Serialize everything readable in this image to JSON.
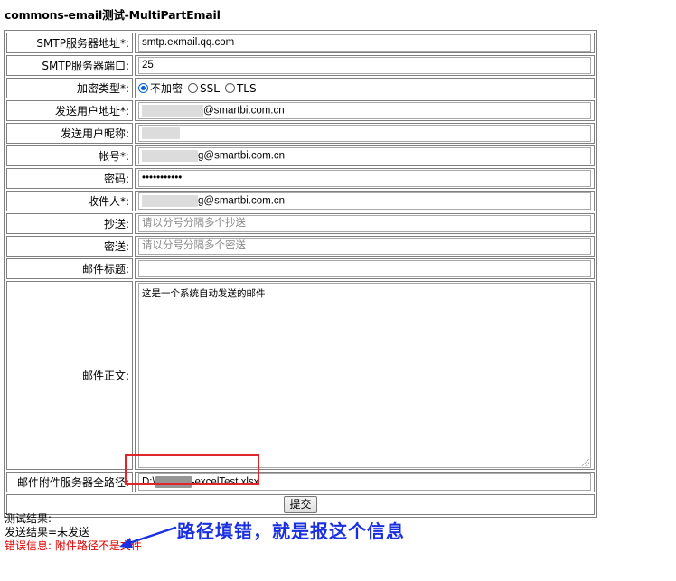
{
  "page": {
    "title": "commons-email测试-MultiPartEmail"
  },
  "form": {
    "smtp_host": {
      "label": "SMTP服务器地址*:",
      "value": "smtp.exmail.qq.com"
    },
    "smtp_port": {
      "label": "SMTP服务器端口:",
      "value": "25"
    },
    "encryption": {
      "label": "加密类型*:",
      "options": [
        "不加密",
        "SSL",
        "TLS"
      ],
      "selected": "不加密"
    },
    "sender_address": {
      "label": "发送用户地址*:",
      "value_suffix": "@smartbi.com.cn"
    },
    "sender_nickname": {
      "label": "发送用户昵称:"
    },
    "account": {
      "label": "帐号*:",
      "value_suffix": "g@smartbi.com.cn"
    },
    "password": {
      "label": "密码:",
      "value": "•••••••••••"
    },
    "recipient": {
      "label": "收件人*:",
      "value_suffix": "g@smartbi.com.cn"
    },
    "cc": {
      "label": "抄送:",
      "placeholder": "请以分号分隔多个抄送"
    },
    "bcc": {
      "label": "密送:",
      "placeholder": "请以分号分隔多个密送"
    },
    "subject": {
      "label": "邮件标题:",
      "value": ""
    },
    "body": {
      "label": "邮件正文:",
      "value": "这是一个系统自动发送的邮件"
    },
    "attachment_path": {
      "label": "邮件附件服务器全路径:",
      "value_prefix": "D:\\",
      "value_suffix": "-excelTest.xlsx"
    },
    "submit_label": "提交"
  },
  "results": {
    "heading": "测试结果:",
    "send_result": "发送结果=未发送",
    "error": "错误信息: 附件路径不是文件"
  },
  "annotation": {
    "text": "路径填错，就是报这个信息",
    "color": "#1a2fe0"
  },
  "colors": {
    "highlight_border": "#e0262b",
    "error_text": "#e00000",
    "radio_accent": "#0060df"
  }
}
